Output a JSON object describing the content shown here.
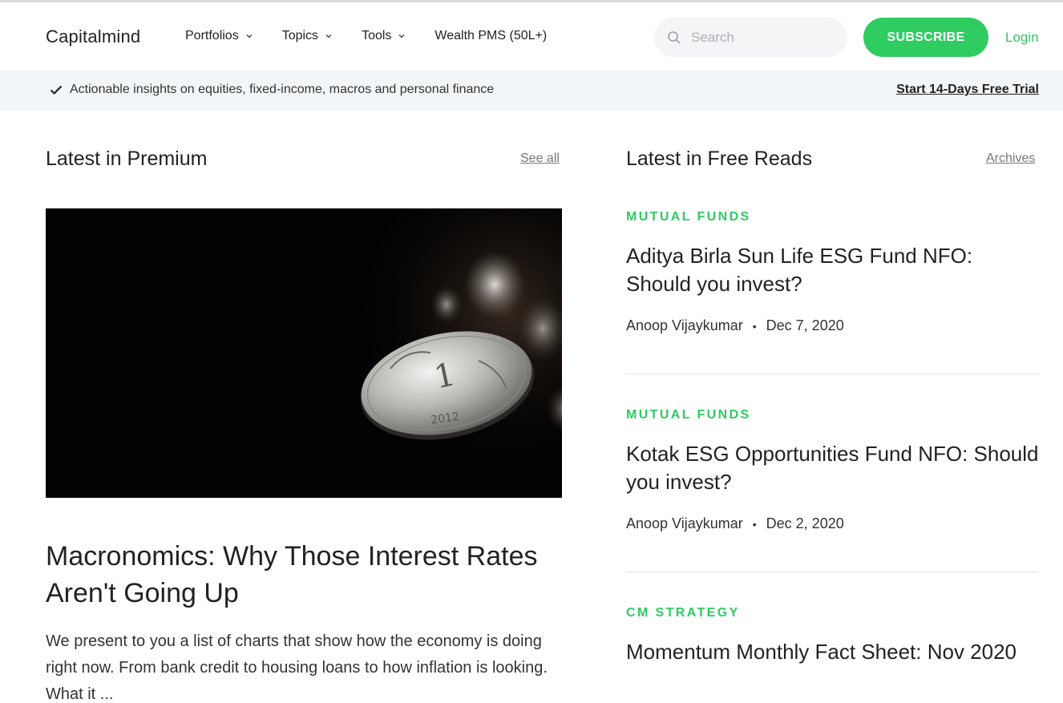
{
  "header": {
    "logo": "Capitalmind",
    "nav": [
      {
        "label": "Portfolios",
        "has_dropdown": true
      },
      {
        "label": "Topics",
        "has_dropdown": true
      },
      {
        "label": "Tools",
        "has_dropdown": true
      },
      {
        "label": "Wealth PMS (50L+)",
        "has_dropdown": false
      }
    ],
    "search": {
      "placeholder": "Search",
      "value": "",
      "icon": "search-icon"
    },
    "subscribe_label": "SUBSCRIBE",
    "login_label": "Login"
  },
  "strip": {
    "icon": "checkmark-icon",
    "message": "Actionable insights on equities, fixed-income, macros and personal finance",
    "trial_link": "Start 14-Days Free Trial"
  },
  "premium": {
    "title": "Latest in Premium",
    "see_all": "See all",
    "featured": {
      "headline": "Macronomics: Why Those Interest Rates Aren't Going Up",
      "excerpt": "We present to you a list of charts that show how the economy is doing right now. From bank credit to housing loans to how inflation is looking. What it ..."
    }
  },
  "free_reads": {
    "title": "Latest in Free Reads",
    "archives": "Archives",
    "articles": [
      {
        "category": "MUTUAL FUNDS",
        "title": "Aditya Birla Sun Life ESG Fund NFO: Should you invest?",
        "author": "Anoop Vijaykumar",
        "date": "Dec 7, 2020"
      },
      {
        "category": "MUTUAL FUNDS",
        "title": "Kotak ESG Opportunities Fund NFO: Should you invest?",
        "author": "Anoop Vijaykumar",
        "date": "Dec 2, 2020"
      },
      {
        "category": "CM STRATEGY",
        "title": "Momentum Monthly Fact Sheet: Nov 2020"
      }
    ],
    "separator": "•"
  },
  "colors": {
    "accent": "#2ecc61",
    "strip_bg": "#f3f6f8",
    "text": "#222222"
  }
}
